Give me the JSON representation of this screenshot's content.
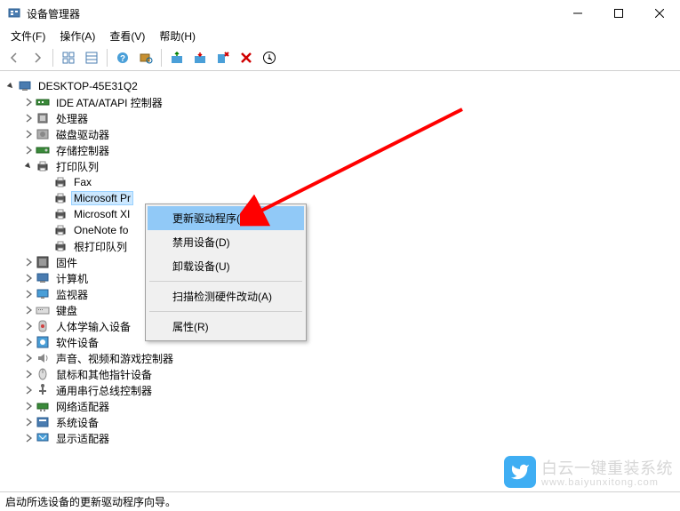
{
  "window": {
    "title": "设备管理器"
  },
  "menubar": {
    "file": "文件(F)",
    "action": "操作(A)",
    "view": "查看(V)",
    "help": "帮助(H)"
  },
  "tree": {
    "root": "DESKTOP-45E31Q2",
    "items": [
      {
        "label": "IDE ATA/ATAPI 控制器",
        "icon": "ide",
        "indent": 1,
        "expander": "closed"
      },
      {
        "label": "处理器",
        "icon": "cpu",
        "indent": 1,
        "expander": "closed"
      },
      {
        "label": "磁盘驱动器",
        "icon": "disk",
        "indent": 1,
        "expander": "closed"
      },
      {
        "label": "存储控制器",
        "icon": "storage",
        "indent": 1,
        "expander": "closed"
      },
      {
        "label": "打印队列",
        "icon": "printer",
        "indent": 1,
        "expander": "open"
      },
      {
        "label": "Fax",
        "icon": "printer",
        "indent": 2,
        "expander": "none"
      },
      {
        "label": "Microsoft Pr",
        "icon": "printer",
        "indent": 2,
        "expander": "none",
        "selected": true,
        "truncated": true
      },
      {
        "label": "Microsoft XI",
        "icon": "printer",
        "indent": 2,
        "expander": "none",
        "truncated": true
      },
      {
        "label": "OneNote fo",
        "icon": "printer",
        "indent": 2,
        "expander": "none",
        "truncated": true
      },
      {
        "label": "根打印队列",
        "icon": "printer",
        "indent": 2,
        "expander": "none"
      },
      {
        "label": "固件",
        "icon": "firmware",
        "indent": 1,
        "expander": "closed"
      },
      {
        "label": "计算机",
        "icon": "computer",
        "indent": 1,
        "expander": "closed"
      },
      {
        "label": "监视器",
        "icon": "monitor",
        "indent": 1,
        "expander": "closed"
      },
      {
        "label": "键盘",
        "icon": "keyboard",
        "indent": 1,
        "expander": "closed"
      },
      {
        "label": "人体学输入设备",
        "icon": "hid",
        "indent": 1,
        "expander": "closed"
      },
      {
        "label": "软件设备",
        "icon": "software",
        "indent": 1,
        "expander": "closed"
      },
      {
        "label": "声音、视频和游戏控制器",
        "icon": "audio",
        "indent": 1,
        "expander": "closed"
      },
      {
        "label": "鼠标和其他指针设备",
        "icon": "mouse",
        "indent": 1,
        "expander": "closed"
      },
      {
        "label": "通用串行总线控制器",
        "icon": "usb",
        "indent": 1,
        "expander": "closed"
      },
      {
        "label": "网络适配器",
        "icon": "network",
        "indent": 1,
        "expander": "closed"
      },
      {
        "label": "系统设备",
        "icon": "system",
        "indent": 1,
        "expander": "closed"
      },
      {
        "label": "显示适配器",
        "icon": "display",
        "indent": 1,
        "expander": "closed"
      }
    ]
  },
  "context_menu": {
    "update_driver": "更新驱动程序(P)",
    "disable": "禁用设备(D)",
    "uninstall": "卸载设备(U)",
    "scan": "扫描检测硬件改动(A)",
    "properties": "属性(R)"
  },
  "statusbar": {
    "text": "启动所选设备的更新驱动程序向导。"
  },
  "watermark": {
    "text": "白云一键重装系统",
    "url": "www.baiyunxitong.com"
  },
  "colors": {
    "selection": "#cce8ff",
    "menu_highlight": "#91c9f7",
    "arrow": "#ff0000"
  }
}
